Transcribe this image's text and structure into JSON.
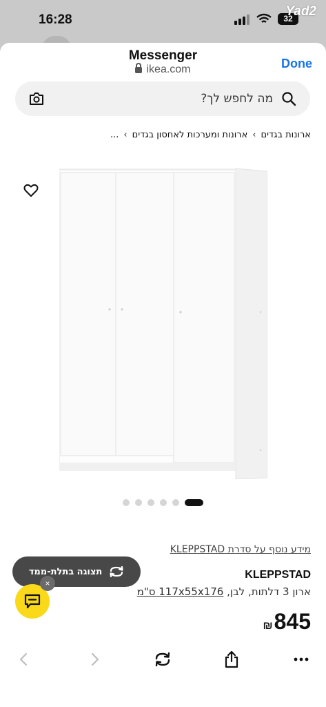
{
  "status_bar": {
    "time": "16:28",
    "battery": "32",
    "watermark": "Yad2"
  },
  "sheet": {
    "title": "Messenger",
    "url": "ikea.com",
    "done_label": "Done"
  },
  "search": {
    "placeholder": "מה לחפש לך?"
  },
  "breadcrumb": {
    "items": [
      "...",
      "ארונות ומערכות לאחסון בגדים",
      "ארונות בגדים"
    ]
  },
  "gallery": {
    "view3d_label": "תצוגה בתלת-ממד",
    "total_images": 6,
    "active_index": 0
  },
  "product": {
    "series_link": "מידע נוסף על סדרת KLEPPSTAD",
    "name": "KLEPPSTAD",
    "description": "ארון 3 דלתות, לבן,",
    "dimensions": "117x55x176 ס\"מ",
    "price": "845",
    "currency": "₪"
  },
  "chat": {
    "close_label": "×"
  },
  "colors": {
    "accent_blue": "#1a73e8",
    "chat_yellow": "#f9d91a",
    "pill_dark": "#484848"
  },
  "icons": {
    "heart": "heart-icon",
    "camera": "camera-icon",
    "search": "search-icon",
    "rotate_3d": "rotate-3d-icon",
    "chat": "chat-icon",
    "back": "chevron-left-icon",
    "forward": "chevron-right-icon",
    "reload": "reload-icon",
    "share": "share-icon",
    "more": "more-icon"
  }
}
